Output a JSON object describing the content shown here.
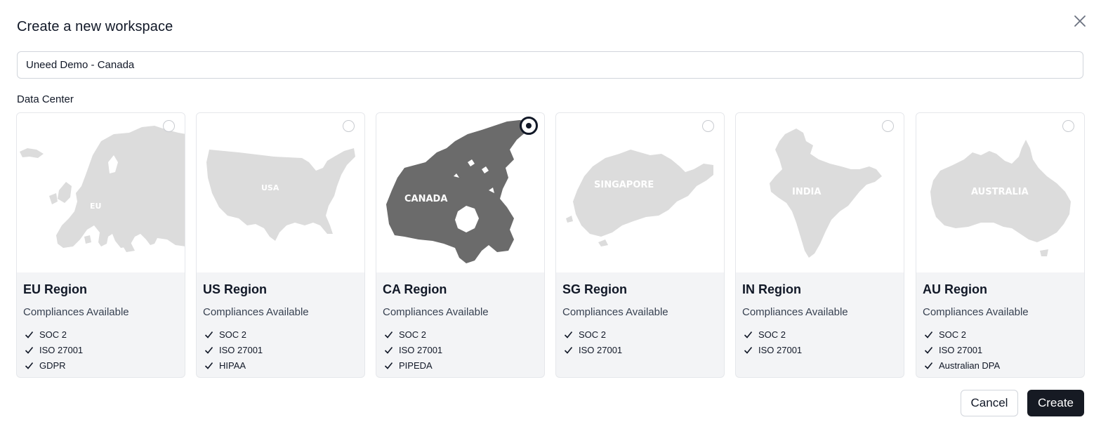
{
  "dialog": {
    "title": "Create a new workspace",
    "close_icon": "close-icon"
  },
  "workspace_name": {
    "value": "Uneed Demo - Canada"
  },
  "data_center": {
    "label": "Data Center",
    "selected_region": "CA Region",
    "regions": [
      {
        "name": "EU Region",
        "map_label": "EU",
        "compliances_label": "Compliances Available",
        "compliances": [
          "SOC 2",
          "ISO 27001",
          "GDPR"
        ],
        "selected": false
      },
      {
        "name": "US Region",
        "map_label": "USA",
        "compliances_label": "Compliances Available",
        "compliances": [
          "SOC 2",
          "ISO 27001",
          "HIPAA"
        ],
        "selected": false
      },
      {
        "name": "CA Region",
        "map_label": "CANADA",
        "compliances_label": "Compliances Available",
        "compliances": [
          "SOC 2",
          "ISO 27001",
          "PIPEDA"
        ],
        "selected": true
      },
      {
        "name": "SG Region",
        "map_label": "SINGAPORE",
        "compliances_label": "Compliances Available",
        "compliances": [
          "SOC 2",
          "ISO 27001"
        ],
        "selected": false
      },
      {
        "name": "IN Region",
        "map_label": "INDIA",
        "compliances_label": "Compliances Available",
        "compliances": [
          "SOC 2",
          "ISO 27001"
        ],
        "selected": false
      },
      {
        "name": "AU Region",
        "map_label": "AUSTRALIA",
        "compliances_label": "Compliances Available",
        "compliances": [
          "SOC 2",
          "ISO 27001",
          "Australian DPA"
        ],
        "selected": false
      }
    ]
  },
  "actions": {
    "cancel_label": "Cancel",
    "create_label": "Create"
  },
  "colors": {
    "map_default": "#dcdcdc",
    "map_selected": "#6b6b6b",
    "primary_button": "#161a23",
    "card_footer": "#f3f4f6"
  }
}
